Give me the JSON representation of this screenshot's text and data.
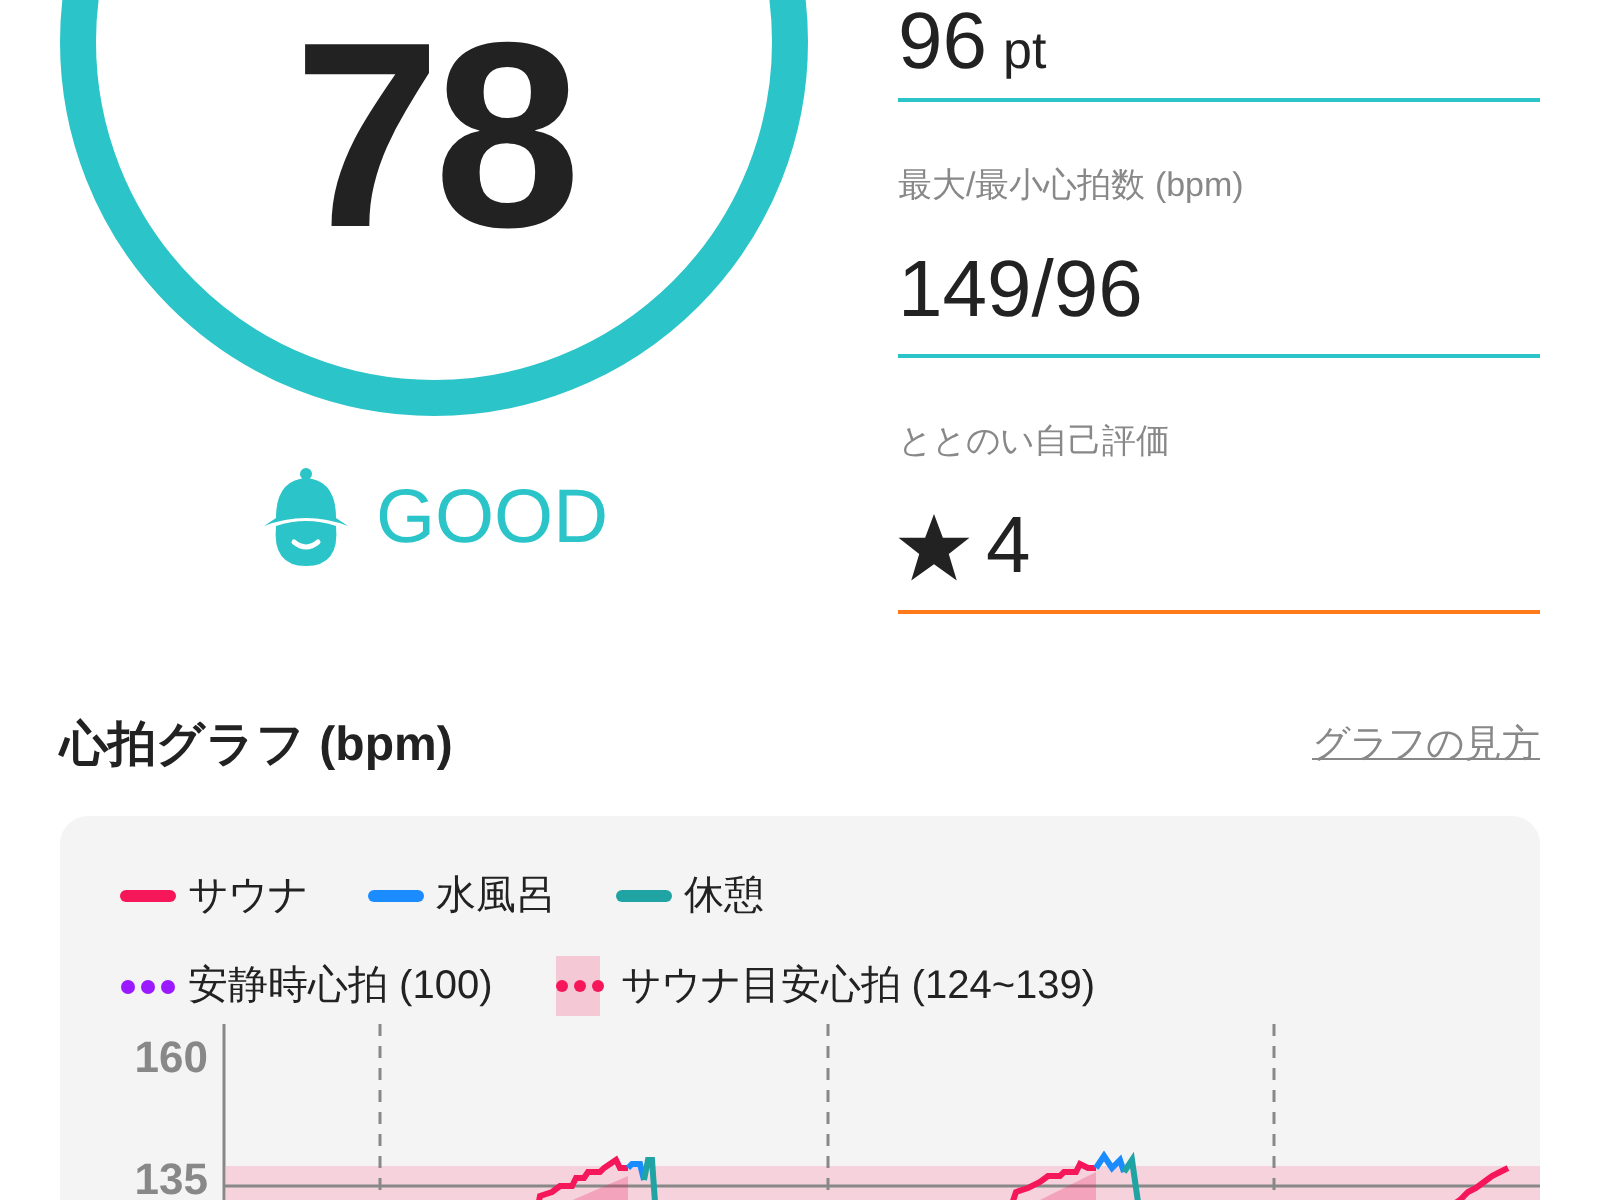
{
  "score": {
    "value": "78",
    "rating": "GOOD"
  },
  "stats": [
    {
      "value": "96",
      "unit": "pt",
      "color": "#2bc4c8"
    },
    {
      "label": "最大/最小心拍数 (bpm)",
      "value": "149/96",
      "color": "#2bc4c8"
    },
    {
      "label": "ととのい自己評価",
      "value": "4",
      "kind": "star",
      "color": "#ff7a1a"
    }
  ],
  "heart_graph": {
    "title": "心拍グラフ (bpm)",
    "help_link": "グラフの見方",
    "legend": [
      {
        "label": "サウナ",
        "kind": "line",
        "color": "#f5175a"
      },
      {
        "label": "水風呂",
        "kind": "line",
        "color": "#1a8cff"
      },
      {
        "label": "休憩",
        "kind": "line",
        "color": "#1fa3a3"
      },
      {
        "label": "安静時心拍 (100)",
        "kind": "dots",
        "color": "#9b1aff"
      },
      {
        "label": "サウナ目安心拍 (124~139)",
        "kind": "band",
        "color": "#f5175a"
      }
    ],
    "y_labels": [
      "160",
      "135"
    ]
  }
}
